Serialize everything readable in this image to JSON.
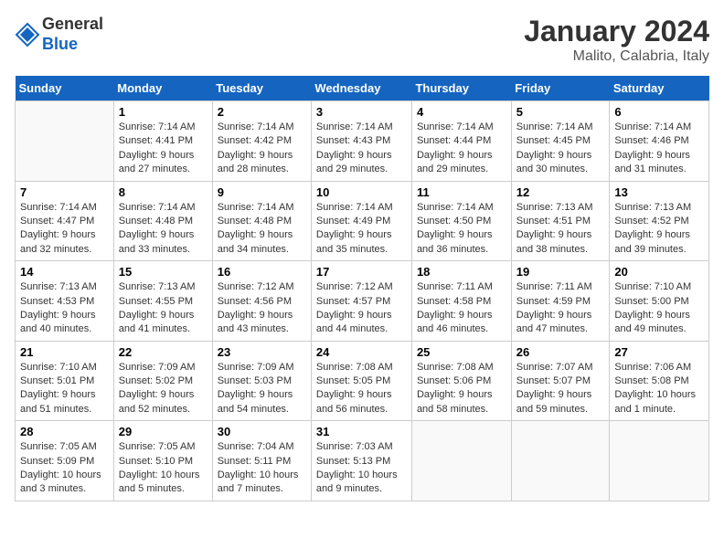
{
  "logo": {
    "general": "General",
    "blue": "Blue"
  },
  "title": "January 2024",
  "location": "Malito, Calabria, Italy",
  "days_of_week": [
    "Sunday",
    "Monday",
    "Tuesday",
    "Wednesday",
    "Thursday",
    "Friday",
    "Saturday"
  ],
  "weeks": [
    [
      {
        "day": "",
        "info": ""
      },
      {
        "day": "1",
        "info": "Sunrise: 7:14 AM\nSunset: 4:41 PM\nDaylight: 9 hours\nand 27 minutes."
      },
      {
        "day": "2",
        "info": "Sunrise: 7:14 AM\nSunset: 4:42 PM\nDaylight: 9 hours\nand 28 minutes."
      },
      {
        "day": "3",
        "info": "Sunrise: 7:14 AM\nSunset: 4:43 PM\nDaylight: 9 hours\nand 29 minutes."
      },
      {
        "day": "4",
        "info": "Sunrise: 7:14 AM\nSunset: 4:44 PM\nDaylight: 9 hours\nand 29 minutes."
      },
      {
        "day": "5",
        "info": "Sunrise: 7:14 AM\nSunset: 4:45 PM\nDaylight: 9 hours\nand 30 minutes."
      },
      {
        "day": "6",
        "info": "Sunrise: 7:14 AM\nSunset: 4:46 PM\nDaylight: 9 hours\nand 31 minutes."
      }
    ],
    [
      {
        "day": "7",
        "info": "Sunrise: 7:14 AM\nSunset: 4:47 PM\nDaylight: 9 hours\nand 32 minutes."
      },
      {
        "day": "8",
        "info": "Sunrise: 7:14 AM\nSunset: 4:48 PM\nDaylight: 9 hours\nand 33 minutes."
      },
      {
        "day": "9",
        "info": "Sunrise: 7:14 AM\nSunset: 4:48 PM\nDaylight: 9 hours\nand 34 minutes."
      },
      {
        "day": "10",
        "info": "Sunrise: 7:14 AM\nSunset: 4:49 PM\nDaylight: 9 hours\nand 35 minutes."
      },
      {
        "day": "11",
        "info": "Sunrise: 7:14 AM\nSunset: 4:50 PM\nDaylight: 9 hours\nand 36 minutes."
      },
      {
        "day": "12",
        "info": "Sunrise: 7:13 AM\nSunset: 4:51 PM\nDaylight: 9 hours\nand 38 minutes."
      },
      {
        "day": "13",
        "info": "Sunrise: 7:13 AM\nSunset: 4:52 PM\nDaylight: 9 hours\nand 39 minutes."
      }
    ],
    [
      {
        "day": "14",
        "info": "Sunrise: 7:13 AM\nSunset: 4:53 PM\nDaylight: 9 hours\nand 40 minutes."
      },
      {
        "day": "15",
        "info": "Sunrise: 7:13 AM\nSunset: 4:55 PM\nDaylight: 9 hours\nand 41 minutes."
      },
      {
        "day": "16",
        "info": "Sunrise: 7:12 AM\nSunset: 4:56 PM\nDaylight: 9 hours\nand 43 minutes."
      },
      {
        "day": "17",
        "info": "Sunrise: 7:12 AM\nSunset: 4:57 PM\nDaylight: 9 hours\nand 44 minutes."
      },
      {
        "day": "18",
        "info": "Sunrise: 7:11 AM\nSunset: 4:58 PM\nDaylight: 9 hours\nand 46 minutes."
      },
      {
        "day": "19",
        "info": "Sunrise: 7:11 AM\nSunset: 4:59 PM\nDaylight: 9 hours\nand 47 minutes."
      },
      {
        "day": "20",
        "info": "Sunrise: 7:10 AM\nSunset: 5:00 PM\nDaylight: 9 hours\nand 49 minutes."
      }
    ],
    [
      {
        "day": "21",
        "info": "Sunrise: 7:10 AM\nSunset: 5:01 PM\nDaylight: 9 hours\nand 51 minutes."
      },
      {
        "day": "22",
        "info": "Sunrise: 7:09 AM\nSunset: 5:02 PM\nDaylight: 9 hours\nand 52 minutes."
      },
      {
        "day": "23",
        "info": "Sunrise: 7:09 AM\nSunset: 5:03 PM\nDaylight: 9 hours\nand 54 minutes."
      },
      {
        "day": "24",
        "info": "Sunrise: 7:08 AM\nSunset: 5:05 PM\nDaylight: 9 hours\nand 56 minutes."
      },
      {
        "day": "25",
        "info": "Sunrise: 7:08 AM\nSunset: 5:06 PM\nDaylight: 9 hours\nand 58 minutes."
      },
      {
        "day": "26",
        "info": "Sunrise: 7:07 AM\nSunset: 5:07 PM\nDaylight: 9 hours\nand 59 minutes."
      },
      {
        "day": "27",
        "info": "Sunrise: 7:06 AM\nSunset: 5:08 PM\nDaylight: 10 hours\nand 1 minute."
      }
    ],
    [
      {
        "day": "28",
        "info": "Sunrise: 7:05 AM\nSunset: 5:09 PM\nDaylight: 10 hours\nand 3 minutes."
      },
      {
        "day": "29",
        "info": "Sunrise: 7:05 AM\nSunset: 5:10 PM\nDaylight: 10 hours\nand 5 minutes."
      },
      {
        "day": "30",
        "info": "Sunrise: 7:04 AM\nSunset: 5:11 PM\nDaylight: 10 hours\nand 7 minutes."
      },
      {
        "day": "31",
        "info": "Sunrise: 7:03 AM\nSunset: 5:13 PM\nDaylight: 10 hours\nand 9 minutes."
      },
      {
        "day": "",
        "info": ""
      },
      {
        "day": "",
        "info": ""
      },
      {
        "day": "",
        "info": ""
      }
    ]
  ]
}
